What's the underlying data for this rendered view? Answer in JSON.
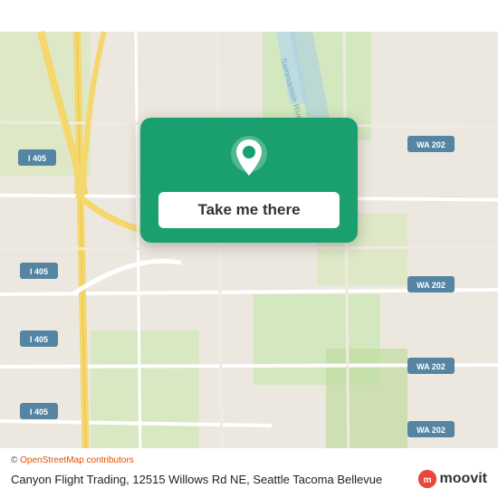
{
  "map": {
    "background_color": "#e8e0d8",
    "accent_green": "#1a9f6e",
    "road_color": "#ffffff",
    "highway_color": "#f5d76e",
    "water_color": "#a8d4e6",
    "park_color": "#c8e6b0"
  },
  "action_card": {
    "button_label": "Take me there",
    "pin_icon": "location-pin"
  },
  "footer": {
    "osm_credit": "© OpenStreetMap contributors",
    "address": "Canyon Flight Trading, 12515 Willows Rd NE, Seattle Tacoma Bellevue",
    "brand": "moovit"
  }
}
